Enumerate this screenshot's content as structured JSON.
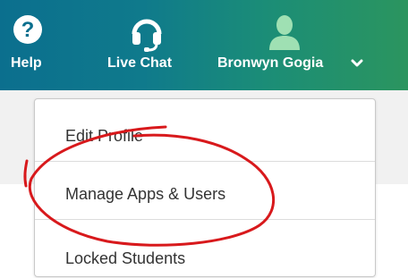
{
  "header": {
    "help_label": "Help",
    "chat_label": "Live Chat",
    "user_name": "Bronwyn Gogia"
  },
  "icons": {
    "help": "help-circle-icon",
    "chat": "headset-icon",
    "user": "user-silhouette-icon",
    "caret": "chevron-down-icon"
  },
  "dropdown": {
    "items": [
      {
        "label": "Edit Profile"
      },
      {
        "label": "Manage Apps & Users"
      },
      {
        "label": "Locked Students"
      }
    ]
  },
  "colors": {
    "header_start": "#0b6f8e",
    "header_end": "#2b955f",
    "annotation": "#d8191c",
    "menu_text": "#333333"
  }
}
